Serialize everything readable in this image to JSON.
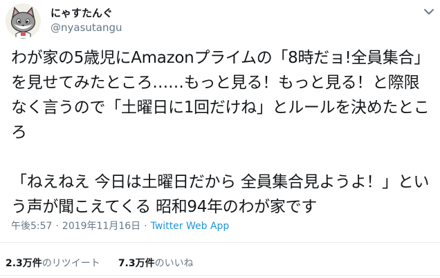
{
  "user": {
    "display_name": "にゃすたんぐ",
    "handle": "@nyasutangu",
    "avatar_icon": "gray-cat-avatar-icon"
  },
  "menu": {
    "icon": "chevron-down-icon"
  },
  "tweet": {
    "text": "わが家の5歳児にAmazonプライムの「8時だョ!全員集合」を見せてみたところ……もっと見る！もっと見る！と際限なく言うので「土曜日に1回だけね」とルールを決めたところ\n\n「ねえねえ 今日は土曜日だから 全員集合見ようよ！」という声が聞こえてくる 昭和94年のわが家です"
  },
  "meta": {
    "time": "午後5:57",
    "separator": "·",
    "date": "2019年11月16日",
    "source": "Twitter Web App"
  },
  "stats": {
    "retweets_count": "2.3万件",
    "retweets_label": "のリツイート",
    "likes_count": "7.3万件",
    "likes_label": "のいいね"
  },
  "colors": {
    "text": "#14171a",
    "secondary": "#657786",
    "link": "#1b95e0",
    "divider": "#e6ecf0"
  }
}
